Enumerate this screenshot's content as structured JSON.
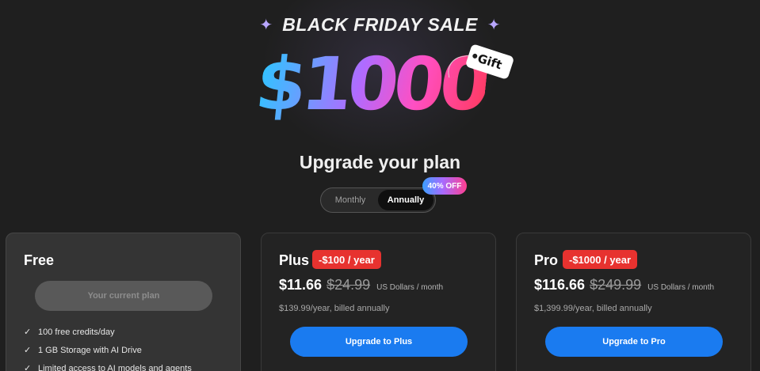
{
  "promo": {
    "title": "BLACK FRIDAY SALE",
    "amount": "$1000",
    "gift_tag": "Gift"
  },
  "page_title": "Upgrade your plan",
  "billing_toggle": {
    "options": [
      "Monthly",
      "Annually"
    ],
    "selected": "Annually",
    "badge": "40% OFF"
  },
  "plans": {
    "free": {
      "name": "Free",
      "button": "Your current plan",
      "features": [
        "100 free credits/day",
        "1 GB Storage with AI Drive",
        "Limited access to AI models and agents"
      ]
    },
    "plus": {
      "name": "Plus",
      "discount": "-$100 / year",
      "price": "$11.66",
      "old_price": "$24.99",
      "unit": "US Dollars / month",
      "billed": "$139.99/year, billed annually",
      "button": "Upgrade to Plus"
    },
    "pro": {
      "name": "Pro",
      "discount": "-$1000 / year",
      "price": "$116.66",
      "old_price": "$249.99",
      "unit": "US Dollars / month",
      "billed": "$1,399.99/year, billed annually",
      "button": "Upgrade to Pro"
    }
  },
  "colors": {
    "background": "#1f1f1f",
    "accent_blue": "#1a7bf0",
    "discount_red": "#e7322f"
  },
  "icons": [
    "sparkle-icon",
    "check-icon"
  ]
}
